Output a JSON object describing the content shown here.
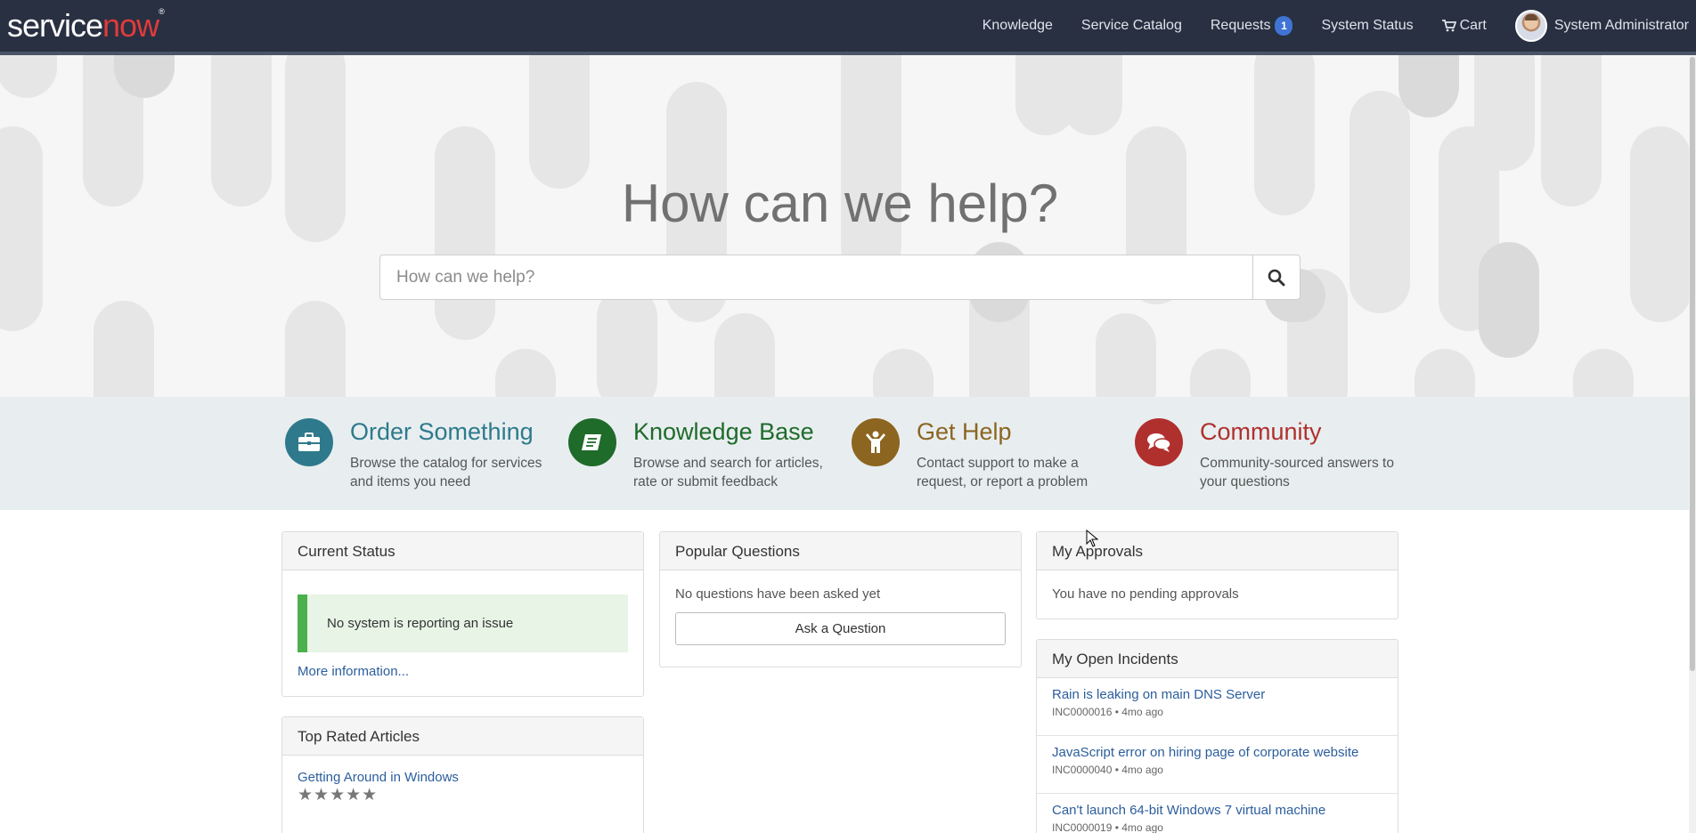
{
  "header": {
    "logo_service": "service",
    "logo_now": "now",
    "nav": [
      {
        "label": "Knowledge"
      },
      {
        "label": "Service Catalog"
      },
      {
        "label": "Requests",
        "badge": "1"
      },
      {
        "label": "System Status"
      },
      {
        "label": "Cart",
        "icon": "cart-icon"
      },
      {
        "label": "System Administrator",
        "icon": "avatar"
      }
    ]
  },
  "hero": {
    "title": "How can we help?",
    "search_placeholder": "How can we help?",
    "search_icon": "search-icon"
  },
  "quick_links": [
    {
      "title": "Order Something",
      "desc": "Browse the catalog for services and items you need",
      "color": "#2e7a8c",
      "icon": "briefcase-icon"
    },
    {
      "title": "Knowledge Base",
      "desc": "Browse and search for articles, rate or submit feedback",
      "color": "#1f6b2a",
      "icon": "book-icon"
    },
    {
      "title": "Get Help",
      "desc": "Contact support to make a request, or report a problem",
      "color": "#8c6520",
      "icon": "person-icon"
    },
    {
      "title": "Community",
      "desc": "Community-sourced answers to your questions",
      "color": "#b0302e",
      "icon": "comments-icon"
    }
  ],
  "current_status": {
    "title": "Current Status",
    "message": "No system is reporting an issue",
    "more_link": "More information..."
  },
  "top_rated": {
    "title": "Top Rated Articles",
    "articles": [
      {
        "title": "Getting Around in Windows",
        "stars": "★★★★★",
        "rating": 5
      }
    ]
  },
  "popular_questions": {
    "title": "Popular Questions",
    "empty": "No questions have been asked yet",
    "ask_button": "Ask a Question"
  },
  "my_approvals": {
    "title": "My Approvals",
    "empty": "You have no pending approvals"
  },
  "my_incidents": {
    "title": "My Open Incidents",
    "items": [
      {
        "title": "Rain is leaking on main DNS Server",
        "meta": "INC0000016 • 4mo ago"
      },
      {
        "title": "JavaScript error on hiring page of corporate website",
        "meta": "INC0000040 • 4mo ago"
      },
      {
        "title": "Can't launch 64-bit Windows 7 virtual machine",
        "meta": "INC0000019 • 4mo ago"
      }
    ]
  },
  "colors": {
    "topbar": "#293042",
    "badge": "#3f74d4",
    "link": "#2b5e9c",
    "status_ok": "#4cb04c"
  }
}
